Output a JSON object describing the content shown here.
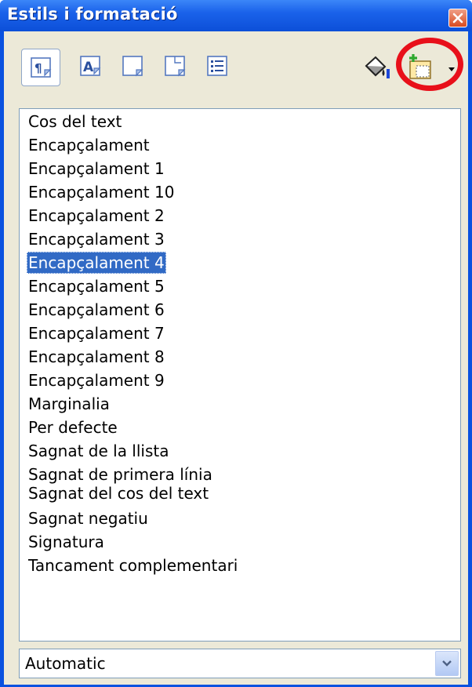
{
  "window": {
    "title": "Estils i formatació"
  },
  "toolbar": {
    "buttons": [
      {
        "name": "paragraph-styles",
        "icon": "paragraph-styles-icon"
      },
      {
        "name": "character-styles",
        "icon": "character-styles-icon"
      },
      {
        "name": "frame-styles",
        "icon": "frame-styles-icon"
      },
      {
        "name": "page-styles",
        "icon": "page-styles-icon"
      },
      {
        "name": "list-styles",
        "icon": "list-styles-icon"
      },
      {
        "name": "fill-format-mode",
        "icon": "paint-bucket-icon"
      },
      {
        "name": "new-style-from-selection",
        "icon": "new-style-icon"
      },
      {
        "name": "new-style-menu",
        "icon": "dropdown-arrow-icon"
      }
    ],
    "active": "paragraph-styles",
    "highlight_color": "#e8101a"
  },
  "styles_list": {
    "items": [
      "Cos del text",
      "Encapçalament",
      "Encapçalament 1",
      "Encapçalament 10",
      "Encapçalament 2",
      "Encapçalament 3",
      "Encapçalament 4",
      "Encapçalament 5",
      "Encapçalament 6",
      "Encapçalament 7",
      "Encapçalament 8",
      "Encapçalament 9",
      "Marginalia",
      "Per defecte",
      "Sagnat de la llista",
      "Sagnat de primera línia",
      "Sagnat del cos del text",
      "Sagnat negatiu",
      "Signatura",
      "Tancament complementari"
    ],
    "selected_index": 6
  },
  "filter": {
    "value": "Automatic"
  },
  "colors": {
    "titlebar": "#0c4fd8",
    "selection": "#316ac5",
    "panel": "#ece9d8"
  }
}
